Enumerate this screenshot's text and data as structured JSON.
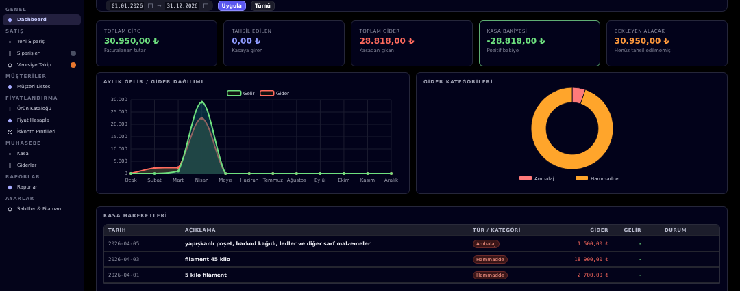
{
  "sidebar": {
    "sections": [
      {
        "title": "GENEL",
        "items": [
          {
            "label": "Dashboard",
            "selected": true
          }
        ]
      },
      {
        "title": "SATIŞ",
        "items": [
          {
            "label": "Yeni Sipariş",
            "selected": false
          },
          {
            "label": "Siparişler",
            "selected": false,
            "color": "#4a4f63"
          },
          {
            "label": "Veresiye Takip",
            "selected": false,
            "color": "#e8772e"
          }
        ]
      },
      {
        "title": "MÜŞTERİLER",
        "items": [
          {
            "label": "Müşteri Listesi",
            "selected": false
          }
        ]
      },
      {
        "title": "FİYATLANDIRMA",
        "items": [
          {
            "label": "Ürün Kataloğu",
            "selected": false
          },
          {
            "label": "Fiyat Hesapla",
            "selected": false
          },
          {
            "label": "İskonto Profilleri",
            "selected": false
          }
        ]
      },
      {
        "title": "MUHASEBE",
        "items": [
          {
            "label": "Kasa",
            "selected": false
          },
          {
            "label": "Giderler",
            "selected": false
          }
        ]
      },
      {
        "title": "RAPORLAR",
        "items": [
          {
            "label": "Raporlar",
            "selected": false
          }
        ]
      },
      {
        "title": "AYARLAR",
        "items": [
          {
            "label": "Sabitler & Filaman",
            "selected": false
          }
        ]
      }
    ]
  },
  "filter": {
    "start_date": "01.01.2026",
    "end_date": "31.12.2026",
    "separator": "→",
    "apply": "Uygula",
    "all": "Tümü"
  },
  "cards": [
    {
      "title": "TOPLAM CİRO",
      "value": "30.950,00 ₺",
      "note": "Faturalanan tutar",
      "color": "#6ee07f",
      "highlighted": false
    },
    {
      "title": "TAHSİL EDİLEN",
      "value": "0,00 ₺",
      "note": "Kasaya giren",
      "color": "#8f9bff",
      "highlighted": false
    },
    {
      "title": "TOPLAM GİDER",
      "value": "28.818,00 ₺",
      "note": "Kasadan çıkan",
      "color": "#ff6b5e",
      "highlighted": false
    },
    {
      "title": "KASA BAKİYESİ",
      "value": "-28.818,00 ₺",
      "note": "Pozitif bakiye",
      "color": "#6ee07f",
      "highlighted": true
    },
    {
      "title": "BEKLEYEN ALACAK",
      "value": "30.950,00 ₺",
      "note": "Henüz tahsil edilmemiş",
      "color": "#ff9a3c",
      "highlighted": false
    }
  ],
  "income_chart": {
    "title": "AYLIK GELİR / GİDER DAĞILIMI",
    "chart_data": {
      "type": "area",
      "categories": [
        "Ocak",
        "Şubat",
        "Mart",
        "Nisan",
        "Mayıs",
        "Haziran",
        "Temmuz",
        "Ağustos",
        "Eylül",
        "Ekim",
        "Kasım",
        "Aralık"
      ],
      "series": [
        {
          "name": "Gelir",
          "color": "#6ee07f",
          "values": [
            0,
            0,
            1000,
            29000,
            0,
            0,
            0,
            0,
            0,
            0,
            0,
            0
          ]
        },
        {
          "name": "Gider",
          "color": "#ff6b5e",
          "values": [
            0,
            2200,
            2400,
            22500,
            0,
            0,
            0,
            0,
            0,
            0,
            0,
            0
          ]
        }
      ],
      "ylim": [
        0,
        30000
      ],
      "yticks": [
        {
          "value": 0,
          "label": "0"
        },
        {
          "value": 5000,
          "label": "5.000"
        },
        {
          "value": 10000,
          "label": "10.000"
        },
        {
          "value": 15000,
          "label": "15.000"
        },
        {
          "value": 20000,
          "label": "20.000"
        },
        {
          "value": 25000,
          "label": "25.000"
        },
        {
          "value": 30000,
          "label": "30.000"
        }
      ],
      "grid": true,
      "legend": true
    }
  },
  "expense_chart": {
    "title": "GİDER KATEGORİLERİ",
    "chart_data": {
      "type": "donut",
      "categories": [
        "Ambalaj",
        "Hammadde"
      ],
      "values": [
        5.2,
        94.8
      ],
      "colors": [
        "#ff7a7a",
        "#ffa52b"
      ],
      "legend": true
    }
  },
  "cash_movements": {
    "title": "KASA HAREKETLERİ",
    "columns": [
      "TARİH",
      "AÇIKLAMA",
      "TÜR / KATEGORİ",
      "GİDER",
      "GELİR",
      "DURUM"
    ],
    "rows": [
      {
        "date": "2026-04-05",
        "description": "yapışkanlı poşet, barkod kağıdı, ledler ve diğer sarf malzemeler",
        "category": "Ambalaj",
        "expense": "1.500,00 ₺",
        "income": "-"
      },
      {
        "date": "2026-04-03",
        "description": "filament 45 kilo",
        "category": "Hammadde",
        "expense": "18.900,00 ₺",
        "income": "-"
      },
      {
        "date": "2026-04-01",
        "description": "5 kilo filament",
        "category": "Hammadde",
        "expense": "2.700,00 ₺",
        "income": "-"
      }
    ]
  }
}
